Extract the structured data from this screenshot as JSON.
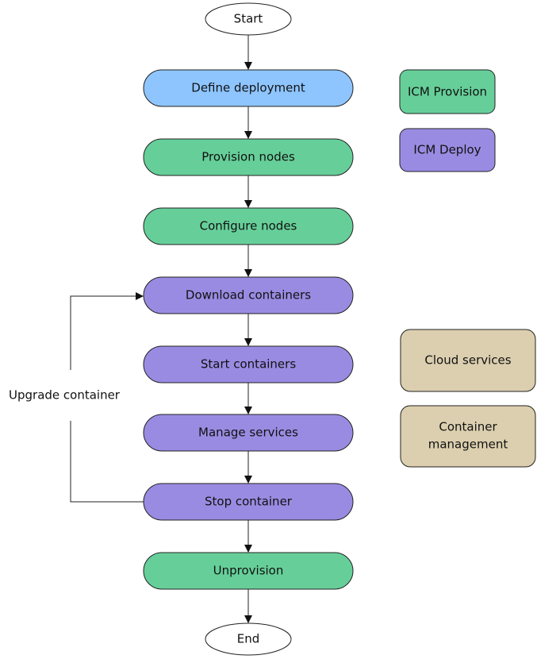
{
  "colors": {
    "define": "#8EC5FF",
    "provision": "#66CF99",
    "deploy": "#9A8BE2",
    "services": "#DCCFAF"
  },
  "flow": {
    "start": "Start",
    "steps": [
      {
        "label": "Define deployment",
        "phase": "define"
      },
      {
        "label": "Provision nodes",
        "phase": "provision"
      },
      {
        "label": "Configure nodes",
        "phase": "provision"
      },
      {
        "label": "Download containers",
        "phase": "deploy"
      },
      {
        "label": "Start containers",
        "phase": "deploy"
      },
      {
        "label": "Manage services",
        "phase": "deploy"
      },
      {
        "label": "Stop container",
        "phase": "deploy"
      },
      {
        "label": "Unprovision",
        "phase": "provision"
      }
    ],
    "end": "End",
    "loop_label": "Upgrade container"
  },
  "legend": {
    "icm_provision": "ICM Provision",
    "icm_deploy": "ICM Deploy",
    "cloud_services": "Cloud services",
    "container_management_line1": "Container",
    "container_management_line2": "management"
  }
}
